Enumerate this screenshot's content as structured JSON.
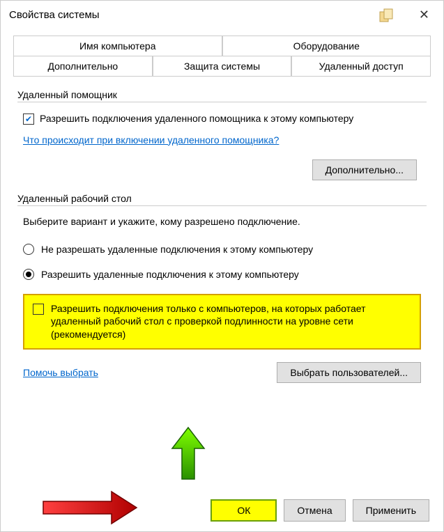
{
  "window": {
    "title": "Свойства системы"
  },
  "tabs": {
    "row1": [
      "Имя компьютера",
      "Оборудование"
    ],
    "row2": [
      "Дополнительно",
      "Защита системы",
      "Удаленный доступ"
    ],
    "active": "Удаленный доступ"
  },
  "remote_assistant": {
    "group_title": "Удаленный помощник",
    "allow_label": "Разрешить подключения удаленного помощника к этому компьютеру",
    "help_link": "Что происходит при включении удаленного помощника?",
    "advanced_btn": "Дополнительно..."
  },
  "remote_desktop": {
    "group_title": "Удаленный рабочий стол",
    "description": "Выберите вариант и укажите, кому разрешено подключение.",
    "radio_deny": "Не разрешать удаленные подключения к этому компьютеру",
    "radio_allow": "Разрешить удаленные подключения к этому компьютеру",
    "nla_checkbox": "Разрешить подключения только с компьютеров, на которых работает удаленный рабочий стол с проверкой подлинности на уровне сети (рекомендуется)",
    "help_choose_link": "Помочь выбрать",
    "select_users_btn": "Выбрать пользователей..."
  },
  "dialog_buttons": {
    "ok": "ОК",
    "cancel": "Отмена",
    "apply": "Применить"
  }
}
